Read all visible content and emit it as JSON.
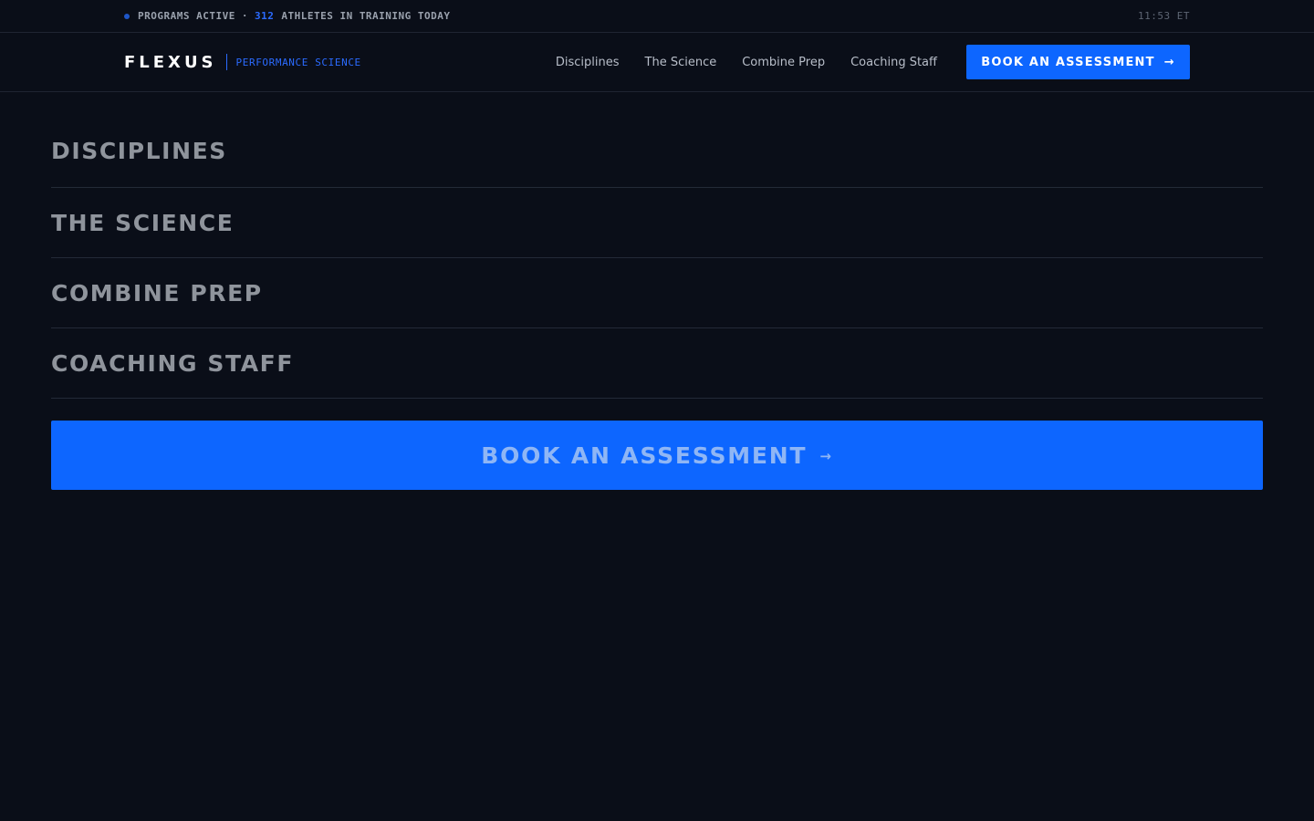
{
  "status": {
    "programs": "PROGRAMS ACTIVE",
    "separator": "·",
    "athlete_count": "312",
    "athletes_text": "ATHLETES IN TRAINING TODAY",
    "clock": "11:53 ET"
  },
  "header": {
    "logo": "FLEXUS",
    "tagline": "PERFORMANCE SCIENCE",
    "nav": [
      "Disciplines",
      "The Science",
      "Combine Prep",
      "Coaching Staff"
    ],
    "cta_label": "BOOK AN ASSESSMENT",
    "cta_icon": "arrow-right-icon"
  },
  "menu": {
    "items": [
      "DISCIPLINES",
      "THE SCIENCE",
      "COMBINE PREP",
      "COACHING STAFF"
    ],
    "cta_label": "BOOK AN ASSESSMENT",
    "cta_icon": "arrow-right-icon"
  },
  "colors": {
    "background": "#0a0e18",
    "accent": "#0d66ff"
  }
}
